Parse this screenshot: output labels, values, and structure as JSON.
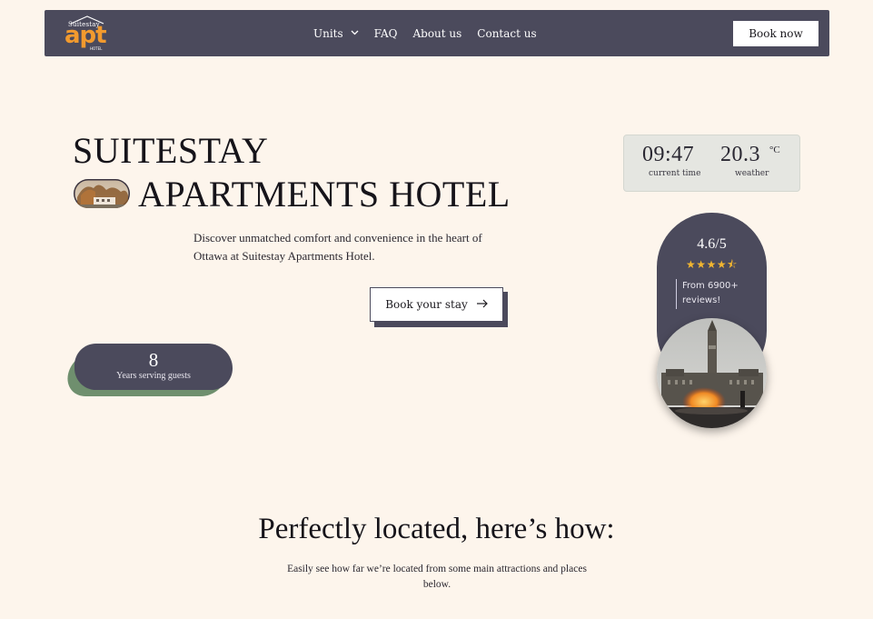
{
  "nav": {
    "logo": {
      "top_text": "Suitestay",
      "main_text": "apt",
      "bottom_text": "HOTEL"
    },
    "links": [
      {
        "label": "Units",
        "has_dropdown": true,
        "icon": "chevron-down-icon"
      },
      {
        "label": "FAQ"
      },
      {
        "label": "About us"
      },
      {
        "label": "Contact us"
      }
    ],
    "book_now_label": "Book now"
  },
  "hero": {
    "title_line1": "SUITESTAY",
    "title_line2": "APARTMENTS HOTEL",
    "description": "Discover unmatched comfort and convenience in the heart of Ottawa at Suitestay Apartments Hotel.",
    "cta_label": "Book your stay",
    "cta_icon": "arrow-right-icon"
  },
  "years_badge": {
    "value": "8",
    "label": "Years serving guests"
  },
  "info_widget": {
    "time_value": "09:47",
    "time_label": "current time",
    "weather_value": "20.3",
    "weather_unit": "°C",
    "weather_label": "weather"
  },
  "rating": {
    "value": "4.6/5",
    "stars": "★★★★⯪",
    "reviews": "From 6900+ reviews!"
  },
  "location_section": {
    "title": "Perfectly located, here’s how:",
    "description": "Easily see how far we’re located from some main attractions and places below."
  },
  "colors": {
    "background": "#fdf5ec",
    "nav": "#4b4a5c",
    "accent_orange": "#f29a2e",
    "green": "#6f8f6e",
    "star": "#f2b630"
  }
}
